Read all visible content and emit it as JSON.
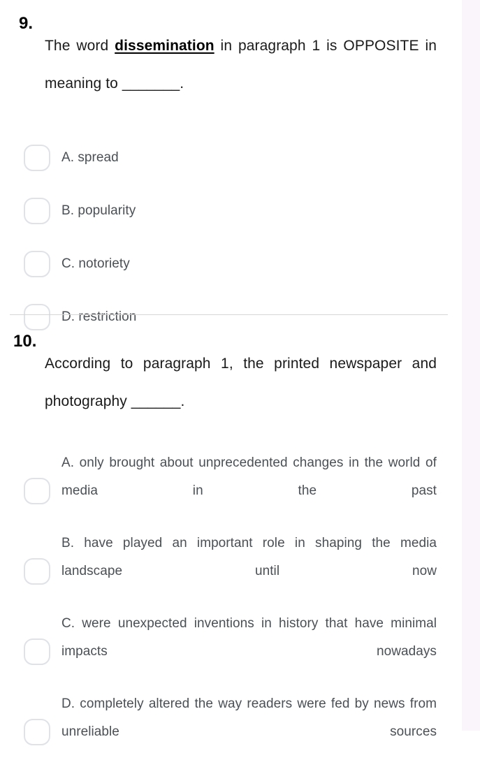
{
  "theme": {
    "page_background": "#ffffff",
    "side_strip": "#f9f5fa",
    "question_text": "#1a1a1a",
    "option_text": "#4a5055",
    "radio_border": "#dfe2e7",
    "divider": "#d6d6d6"
  },
  "questions": [
    {
      "number": "9.",
      "text_before": "The word ",
      "keyword": "dissemination",
      "text_after": " in paragraph 1 is OPPOSITE in meaning to _______.",
      "options": [
        {
          "label": "A. spread"
        },
        {
          "label": "B. popularity"
        },
        {
          "label": "C. notoriety"
        },
        {
          "label": "D. restriction"
        }
      ]
    },
    {
      "number": "10.",
      "text_before": "According to paragraph 1, the printed newspaper and photography ______.",
      "keyword": "",
      "text_after": "",
      "options": [
        {
          "label": "A. only brought about unprecedented changes in the world of media in the past"
        },
        {
          "label": "B. have played an important role in shaping the media landscape until now"
        },
        {
          "label": "C. were unexpected inventions in history that have minimal impacts nowadays"
        },
        {
          "label": "D. completely altered the way readers were fed by news from unreliable sources"
        }
      ]
    }
  ]
}
